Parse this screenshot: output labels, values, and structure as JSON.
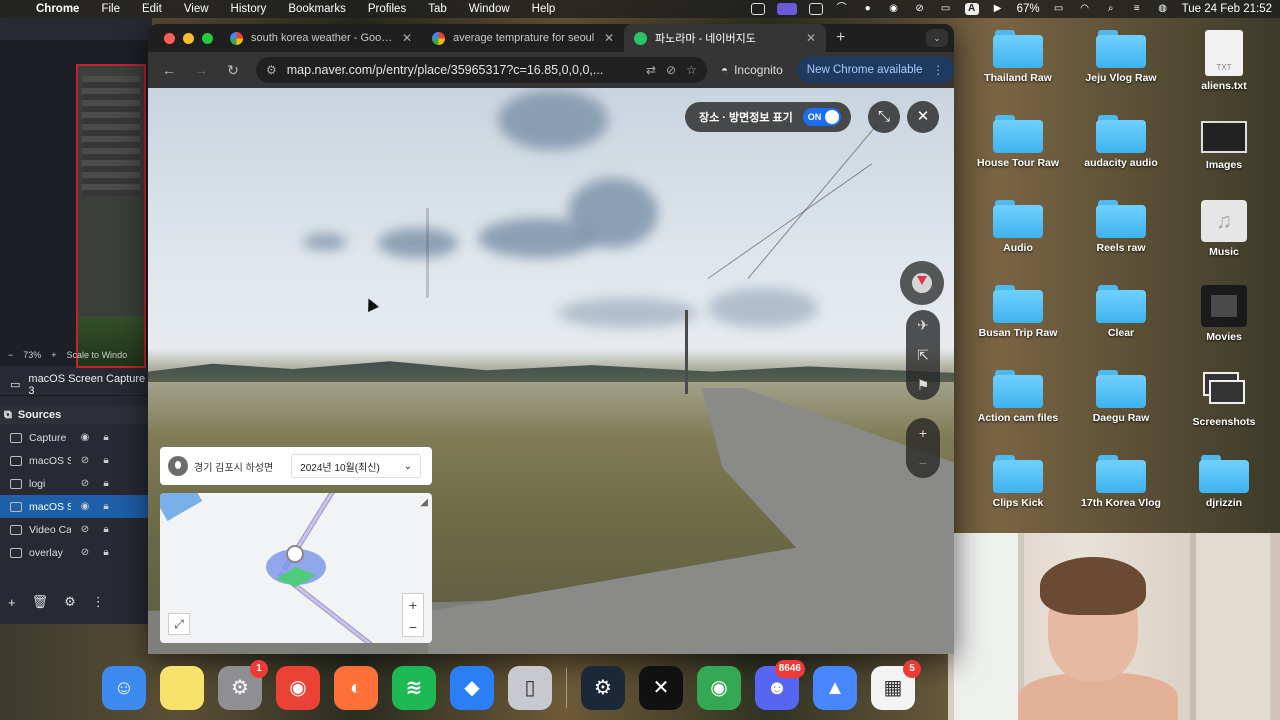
{
  "menubar": {
    "app_name": "Chrome",
    "items": [
      "File",
      "Edit",
      "View",
      "History",
      "Bookmarks",
      "Profiles",
      "Tab",
      "Window",
      "Help"
    ],
    "battery": "67%",
    "datetime": "Tue 24 Feb  21:52",
    "input_source": "A"
  },
  "obs": {
    "zoom": "73%",
    "scale_label": "Scale to Windo",
    "scene_name": "macOS Screen Capture 3",
    "sources_title": "Sources",
    "sources": [
      {
        "name": "Capture",
        "selected": false
      },
      {
        "name": "macOS S",
        "selected": false
      },
      {
        "name": "logi",
        "selected": false
      },
      {
        "name": "macOS S",
        "selected": true
      },
      {
        "name": "Video Ca",
        "selected": false
      },
      {
        "name": "overlay",
        "selected": false
      }
    ]
  },
  "browser": {
    "tabs": [
      {
        "title": "south korea weather - Google",
        "favicon_color": "#4285f4",
        "active": false
      },
      {
        "title": "average temprature for seoul",
        "favicon_color": "#4285f4",
        "active": false
      },
      {
        "title": "파노라마 - 네이버지도",
        "favicon_color": "#2dc26b",
        "active": true
      }
    ],
    "url": "map.naver.com/p/entry/place/35965317?c=16.85,0,0,0,...",
    "incognito_label": "Incognito",
    "update_label": "New Chrome available"
  },
  "panorama": {
    "toggle_label": "장소 · 방면정보 표기",
    "toggle_state": "ON",
    "location": "경기 김포시 하성면",
    "date_selected": "2024년 10월(최신)"
  },
  "desktop": {
    "items": [
      {
        "label": "Thailand Raw",
        "type": "folder"
      },
      {
        "label": "Jeju Vlog Raw",
        "type": "folder"
      },
      {
        "label": "aliens.txt",
        "type": "file",
        "ext": "TXT"
      },
      {
        "label": "House Tour Raw",
        "type": "folder"
      },
      {
        "label": "audacity audio",
        "type": "folder"
      },
      {
        "label": "Images",
        "type": "image"
      },
      {
        "label": "Audio",
        "type": "folder"
      },
      {
        "label": "Reels raw",
        "type": "folder"
      },
      {
        "label": "Music",
        "type": "music"
      },
      {
        "label": "Busan Trip Raw",
        "type": "folder"
      },
      {
        "label": "Clear",
        "type": "folder"
      },
      {
        "label": "Movies",
        "type": "movies"
      },
      {
        "label": "Action cam files",
        "type": "folder"
      },
      {
        "label": "Daegu Raw",
        "type": "folder"
      },
      {
        "label": "Screenshots",
        "type": "screenshots"
      },
      {
        "label": "Clips Kick",
        "type": "folder"
      },
      {
        "label": "17th Korea Vlog",
        "type": "folder"
      },
      {
        "label": "djrizzin",
        "type": "folder"
      }
    ]
  },
  "dock": {
    "apps": [
      {
        "name": "finder-app",
        "color": "#3d8bf0",
        "glyph": "☺",
        "badge": ""
      },
      {
        "name": "notes-app",
        "color": "#f7e36b",
        "glyph": "",
        "badge": ""
      },
      {
        "name": "settings-app",
        "color": "#8e8e93",
        "glyph": "⚙",
        "badge": "1"
      },
      {
        "name": "chrome-app",
        "color": "#ea4335",
        "glyph": "◉",
        "badge": ""
      },
      {
        "name": "firefox-app",
        "color": "#ff7139",
        "glyph": "◐",
        "badge": ""
      },
      {
        "name": "spotify-app",
        "color": "#1db954",
        "glyph": "≋",
        "badge": ""
      },
      {
        "name": "roblox-app",
        "color": "#2b7ff5",
        "glyph": "◆",
        "badge": ""
      },
      {
        "name": "iphone-mirroring-app",
        "color": "#c8c8cf",
        "glyph": "▯",
        "badge": ""
      },
      {
        "name": "steam-app",
        "color": "#1b2838",
        "glyph": "⚙",
        "badge": ""
      },
      {
        "name": "capcut-app",
        "color": "#111111",
        "glyph": "✕",
        "badge": ""
      },
      {
        "name": "chrome-app-2",
        "color": "#34a853",
        "glyph": "◉",
        "badge": ""
      },
      {
        "name": "discord-app",
        "color": "#5865f2",
        "glyph": "☻",
        "badge": "8646"
      },
      {
        "name": "nordvpn-app",
        "color": "#4687ff",
        "glyph": "▲",
        "badge": ""
      },
      {
        "name": "microsoft-app",
        "color": "#f3f3f3",
        "glyph": "▦",
        "badge": "5"
      }
    ]
  }
}
